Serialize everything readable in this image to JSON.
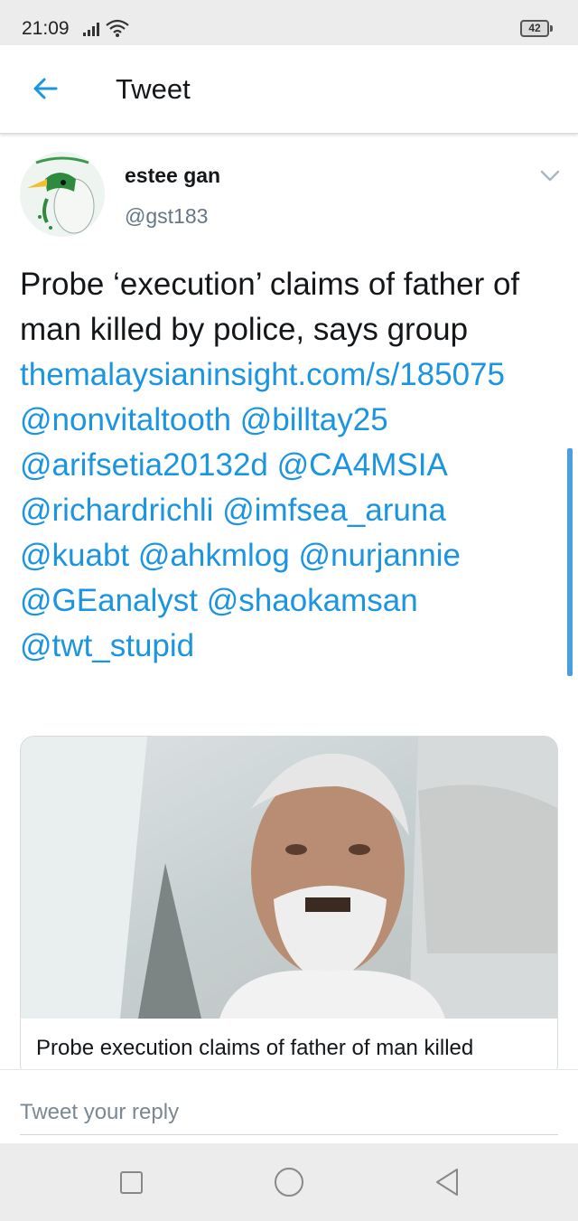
{
  "status_bar": {
    "time": "21:09",
    "battery": "42",
    "icons": [
      "signal-icon",
      "wifi-icon",
      "battery-icon"
    ]
  },
  "header": {
    "title": "Tweet",
    "back_icon": "arrow-left-icon"
  },
  "tweet": {
    "display_name": "estee gan",
    "handle": "@gst183",
    "text_plain": "Probe ‘execution’ claims of father of man killed by police, says group ",
    "link": "themalaysianinsight.com/s/185075",
    "mentions": [
      "@nonvitaltooth",
      "@billtay25",
      "@arifsetia20132d",
      "@CA4MSIA",
      "@richardrichli",
      "@imfsea_aruna",
      "@kuabt",
      "@ahkmlog",
      "@nurjannie",
      "@GEanalyst",
      "@shaokamsan",
      "@twt_stupid"
    ],
    "card": {
      "title": "Probe execution claims of father of man killed"
    }
  },
  "reply": {
    "placeholder": "Tweet your reply"
  },
  "colors": {
    "link": "#1b95e0",
    "text": "#14171a",
    "secondary": "#657786",
    "scrollbar": "#4a9fe0"
  }
}
